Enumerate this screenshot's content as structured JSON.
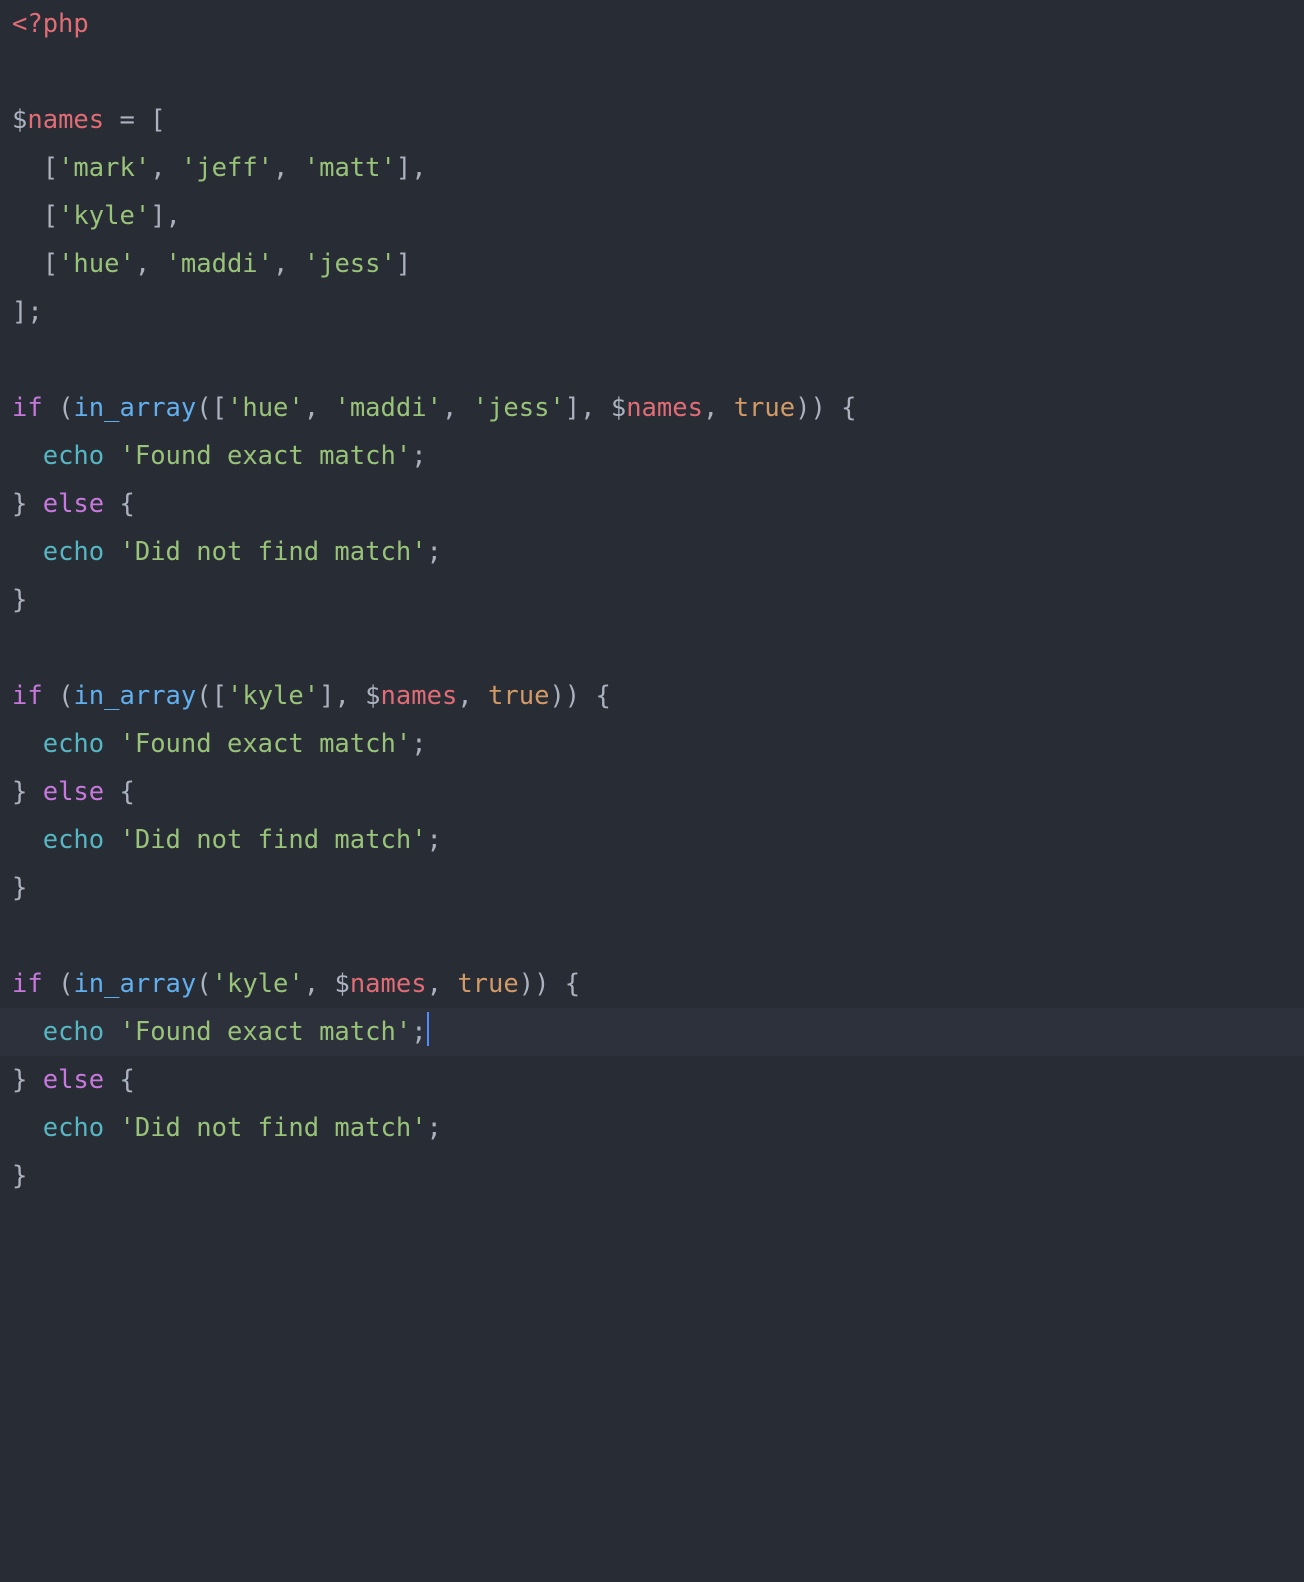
{
  "colors": {
    "background": "#282c34",
    "highlight_line": "#2c313c",
    "default": "#abb2bf",
    "tag_var": "#e06c75",
    "string": "#98c379",
    "keyword": "#c678dd",
    "function": "#61afef",
    "constant": "#d19a66",
    "echo": "#56b6c2",
    "cursor": "#528bff"
  },
  "cursor_line_index": 21,
  "lines": [
    [
      {
        "t": "<?php",
        "c": "c-tag"
      }
    ],
    [],
    [
      {
        "t": "$",
        "c": "c-punc"
      },
      {
        "t": "names",
        "c": "c-tag"
      },
      {
        "t": " = [",
        "c": "c-punc"
      }
    ],
    [
      {
        "t": "  [",
        "c": "c-punc"
      },
      {
        "t": "'mark'",
        "c": "c-str"
      },
      {
        "t": ", ",
        "c": "c-punc"
      },
      {
        "t": "'jeff'",
        "c": "c-str"
      },
      {
        "t": ", ",
        "c": "c-punc"
      },
      {
        "t": "'matt'",
        "c": "c-str"
      },
      {
        "t": "],",
        "c": "c-punc"
      }
    ],
    [
      {
        "t": "  [",
        "c": "c-punc"
      },
      {
        "t": "'kyle'",
        "c": "c-str"
      },
      {
        "t": "],",
        "c": "c-punc"
      }
    ],
    [
      {
        "t": "  [",
        "c": "c-punc"
      },
      {
        "t": "'hue'",
        "c": "c-str"
      },
      {
        "t": ", ",
        "c": "c-punc"
      },
      {
        "t": "'maddi'",
        "c": "c-str"
      },
      {
        "t": ", ",
        "c": "c-punc"
      },
      {
        "t": "'jess'",
        "c": "c-str"
      },
      {
        "t": "]",
        "c": "c-punc"
      }
    ],
    [
      {
        "t": "];",
        "c": "c-punc"
      }
    ],
    [],
    [
      {
        "t": "if",
        "c": "c-kw"
      },
      {
        "t": " (",
        "c": "c-punc"
      },
      {
        "t": "in_array",
        "c": "c-fn"
      },
      {
        "t": "([",
        "c": "c-punc"
      },
      {
        "t": "'hue'",
        "c": "c-str"
      },
      {
        "t": ", ",
        "c": "c-punc"
      },
      {
        "t": "'maddi'",
        "c": "c-str"
      },
      {
        "t": ", ",
        "c": "c-punc"
      },
      {
        "t": "'jess'",
        "c": "c-str"
      },
      {
        "t": "], ",
        "c": "c-punc"
      },
      {
        "t": "$",
        "c": "c-punc"
      },
      {
        "t": "names",
        "c": "c-tag"
      },
      {
        "t": ", ",
        "c": "c-punc"
      },
      {
        "t": "true",
        "c": "c-const"
      },
      {
        "t": ")) {",
        "c": "c-punc"
      }
    ],
    [
      {
        "t": "  ",
        "c": "c-punc"
      },
      {
        "t": "echo",
        "c": "c-echo"
      },
      {
        "t": " ",
        "c": "c-punc"
      },
      {
        "t": "'Found exact match'",
        "c": "c-str"
      },
      {
        "t": ";",
        "c": "c-punc"
      }
    ],
    [
      {
        "t": "} ",
        "c": "c-punc"
      },
      {
        "t": "else",
        "c": "c-kw"
      },
      {
        "t": " {",
        "c": "c-punc"
      }
    ],
    [
      {
        "t": "  ",
        "c": "c-punc"
      },
      {
        "t": "echo",
        "c": "c-echo"
      },
      {
        "t": " ",
        "c": "c-punc"
      },
      {
        "t": "'Did not find match'",
        "c": "c-str"
      },
      {
        "t": ";",
        "c": "c-punc"
      }
    ],
    [
      {
        "t": "}",
        "c": "c-punc"
      }
    ],
    [],
    [
      {
        "t": "if",
        "c": "c-kw"
      },
      {
        "t": " (",
        "c": "c-punc"
      },
      {
        "t": "in_array",
        "c": "c-fn"
      },
      {
        "t": "([",
        "c": "c-punc"
      },
      {
        "t": "'kyle'",
        "c": "c-str"
      },
      {
        "t": "], ",
        "c": "c-punc"
      },
      {
        "t": "$",
        "c": "c-punc"
      },
      {
        "t": "names",
        "c": "c-tag"
      },
      {
        "t": ", ",
        "c": "c-punc"
      },
      {
        "t": "true",
        "c": "c-const"
      },
      {
        "t": ")) {",
        "c": "c-punc"
      }
    ],
    [
      {
        "t": "  ",
        "c": "c-punc"
      },
      {
        "t": "echo",
        "c": "c-echo"
      },
      {
        "t": " ",
        "c": "c-punc"
      },
      {
        "t": "'Found exact match'",
        "c": "c-str"
      },
      {
        "t": ";",
        "c": "c-punc"
      }
    ],
    [
      {
        "t": "} ",
        "c": "c-punc"
      },
      {
        "t": "else",
        "c": "c-kw"
      },
      {
        "t": " {",
        "c": "c-punc"
      }
    ],
    [
      {
        "t": "  ",
        "c": "c-punc"
      },
      {
        "t": "echo",
        "c": "c-echo"
      },
      {
        "t": " ",
        "c": "c-punc"
      },
      {
        "t": "'Did not find match'",
        "c": "c-str"
      },
      {
        "t": ";",
        "c": "c-punc"
      }
    ],
    [
      {
        "t": "}",
        "c": "c-punc"
      }
    ],
    [],
    [
      {
        "t": "if",
        "c": "c-kw"
      },
      {
        "t": " (",
        "c": "c-punc"
      },
      {
        "t": "in_array",
        "c": "c-fn"
      },
      {
        "t": "(",
        "c": "c-punc"
      },
      {
        "t": "'kyle'",
        "c": "c-str"
      },
      {
        "t": ", ",
        "c": "c-punc"
      },
      {
        "t": "$",
        "c": "c-punc"
      },
      {
        "t": "names",
        "c": "c-tag"
      },
      {
        "t": ", ",
        "c": "c-punc"
      },
      {
        "t": "true",
        "c": "c-const"
      },
      {
        "t": ")) {",
        "c": "c-punc"
      }
    ],
    [
      {
        "t": "  ",
        "c": "c-punc"
      },
      {
        "t": "echo",
        "c": "c-echo"
      },
      {
        "t": " ",
        "c": "c-punc"
      },
      {
        "t": "'Found exact match'",
        "c": "c-str"
      },
      {
        "t": ";",
        "c": "c-punc"
      }
    ],
    [
      {
        "t": "} ",
        "c": "c-punc"
      },
      {
        "t": "else",
        "c": "c-kw"
      },
      {
        "t": " {",
        "c": "c-punc"
      }
    ],
    [
      {
        "t": "  ",
        "c": "c-punc"
      },
      {
        "t": "echo",
        "c": "c-echo"
      },
      {
        "t": " ",
        "c": "c-punc"
      },
      {
        "t": "'Did not find match'",
        "c": "c-str"
      },
      {
        "t": ";",
        "c": "c-punc"
      }
    ],
    [
      {
        "t": "}",
        "c": "c-punc"
      }
    ]
  ]
}
